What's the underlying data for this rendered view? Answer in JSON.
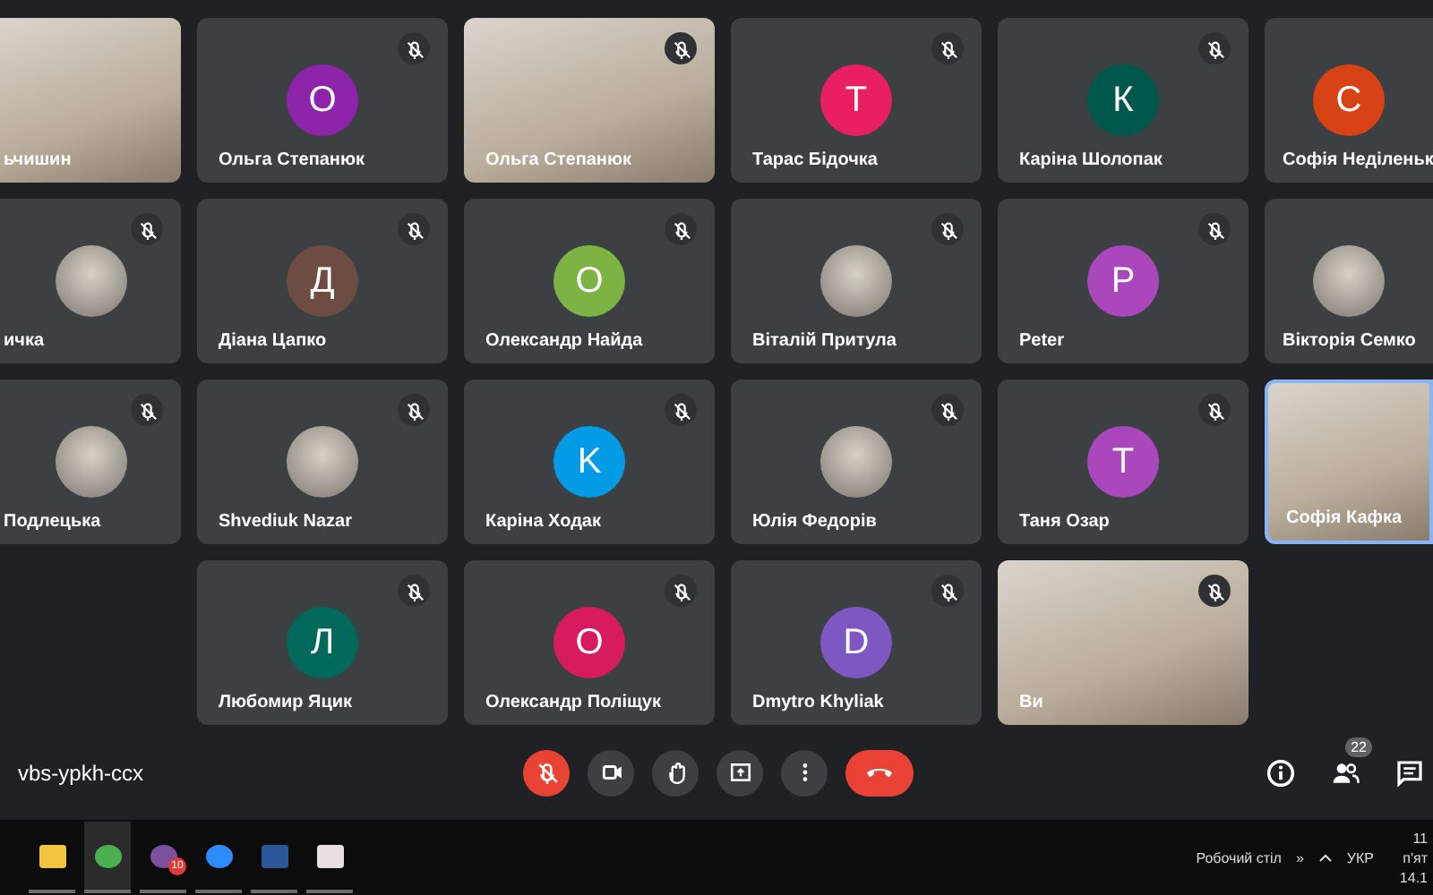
{
  "rows": [
    {
      "tiles": [
        {
          "kind": "video",
          "name": "ьчишин",
          "muted": false,
          "speaking": false
        },
        {
          "kind": "letter",
          "initial": "О",
          "color": "#8e24aa",
          "name": "Ольга Степанюк",
          "muted": true,
          "speaking": false
        },
        {
          "kind": "video",
          "name": "Ольга Степанюк",
          "muted": true,
          "speaking": false
        },
        {
          "kind": "letter",
          "initial": "Т",
          "color": "#e91e63",
          "name": "Тарас Бідочка",
          "muted": true,
          "speaking": false
        },
        {
          "kind": "letter",
          "initial": "К",
          "color": "#00574b",
          "name": "Каріна Шолопак",
          "muted": true,
          "speaking": false
        },
        {
          "kind": "letter",
          "initial": "С",
          "color": "#d84315",
          "name": "Софія Неділеньк",
          "muted": false,
          "speaking": false
        }
      ]
    },
    {
      "tiles": [
        {
          "kind": "photo",
          "name": "ичка",
          "muted": true,
          "speaking": false
        },
        {
          "kind": "letter",
          "initial": "Д",
          "color": "#6d4c41",
          "name": "Діана Цапко",
          "muted": true,
          "speaking": false
        },
        {
          "kind": "letter",
          "initial": "О",
          "color": "#7cb342",
          "name": "Олександр Найда",
          "muted": true,
          "speaking": false
        },
        {
          "kind": "photo",
          "name": "Віталій Притула",
          "muted": true,
          "speaking": false
        },
        {
          "kind": "letter",
          "initial": "P",
          "color": "#ab47bc",
          "name": "Peter",
          "muted": true,
          "speaking": false
        },
        {
          "kind": "photo",
          "name": "Вікторія Семко",
          "muted": false,
          "speaking": false
        }
      ]
    },
    {
      "tiles": [
        {
          "kind": "photo",
          "name": "Подлецька",
          "muted": true,
          "speaking": false
        },
        {
          "kind": "photo",
          "name": "Shvediuk Nazar",
          "muted": true,
          "speaking": false
        },
        {
          "kind": "letter",
          "initial": "K",
          "color": "#039be5",
          "name": "Каріна Ходак",
          "muted": true,
          "speaking": false
        },
        {
          "kind": "photo",
          "name": "Юлія Федорів",
          "muted": true,
          "speaking": false
        },
        {
          "kind": "letter",
          "initial": "Т",
          "color": "#ab47bc",
          "name": "Таня Озар",
          "muted": true,
          "speaking": false
        },
        {
          "kind": "video",
          "name": "Софія Кафка",
          "muted": false,
          "speaking": true
        }
      ]
    },
    {
      "tiles": [
        {
          "kind": "letter",
          "initial": "Л",
          "color": "#00695c",
          "name": "Любомир Яцик",
          "muted": true,
          "speaking": false
        },
        {
          "kind": "letter",
          "initial": "О",
          "color": "#d81b60",
          "name": "Олександр Поліщук",
          "muted": true,
          "speaking": false
        },
        {
          "kind": "letter",
          "initial": "D",
          "color": "#7e57c2",
          "name": "Dmytro Khyliak",
          "muted": true,
          "speaking": false
        },
        {
          "kind": "video",
          "name": "Ви",
          "muted": true,
          "speaking": false
        }
      ]
    }
  ],
  "meeting_code": "vbs-ypkh-ccx",
  "controls": [
    {
      "kind": "mic",
      "on": false
    },
    {
      "kind": "camera",
      "on": true
    },
    {
      "kind": "hand"
    },
    {
      "kind": "present"
    },
    {
      "kind": "more"
    },
    {
      "kind": "hangup"
    }
  ],
  "side_controls": [
    {
      "kind": "info"
    },
    {
      "kind": "people",
      "badge": "22"
    },
    {
      "kind": "chat"
    }
  ],
  "taskbar": {
    "apps": [
      {
        "kind": "folder",
        "selected": false
      },
      {
        "kind": "browser",
        "selected": true
      },
      {
        "kind": "messenger",
        "selected": false,
        "badge": "10"
      },
      {
        "kind": "video",
        "selected": false
      },
      {
        "kind": "word",
        "selected": false
      },
      {
        "kind": "pdf",
        "selected": false
      }
    ],
    "overflow": "»",
    "desktop": "Робочий стіл",
    "language": "УКР",
    "time": "11",
    "day": "п'ят",
    "date": "14.1"
  }
}
